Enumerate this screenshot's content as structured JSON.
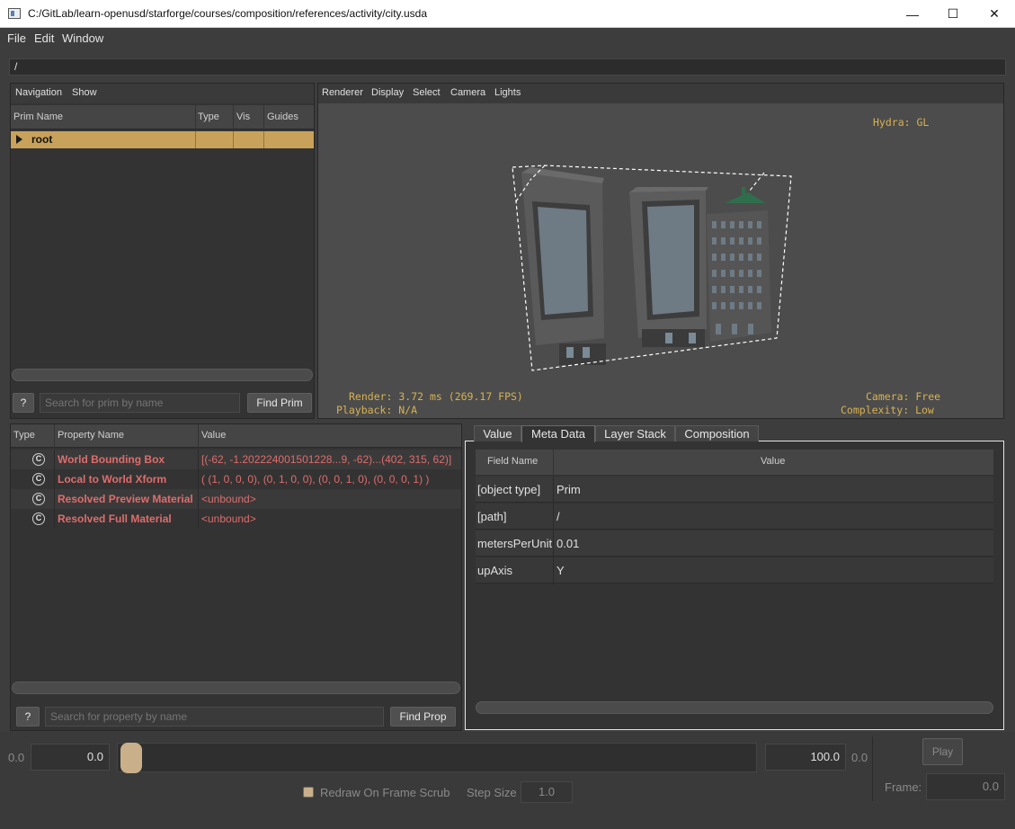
{
  "window": {
    "title": "C:/GitLab/learn-openusd/starforge/courses/composition/references/activity/city.usda",
    "minimize_glyph": "—",
    "maximize_glyph": "☐",
    "close_glyph": "✕"
  },
  "menubar": {
    "items": [
      "File",
      "Edit",
      "Window"
    ]
  },
  "path_field": {
    "value": "/"
  },
  "navigation": {
    "menu": [
      "Navigation",
      "Show"
    ],
    "columns": [
      "Prim Name",
      "Type",
      "Vis",
      "Guides"
    ],
    "rows": [
      {
        "name": "root",
        "type": "",
        "vis": "",
        "guides": ""
      }
    ],
    "help_label": "?",
    "search_placeholder": "Search for prim by name",
    "find_label": "Find Prim"
  },
  "viewport": {
    "menu": [
      "Renderer",
      "Display",
      "Select",
      "Camera",
      "Lights"
    ],
    "hud": {
      "renderer": "Hydra: GL",
      "render": "Render: 3.72 ms (269.17 FPS)",
      "playback": "Playback: N/A",
      "camera": "Camera: Free",
      "complexity": "Complexity: Low"
    }
  },
  "properties": {
    "columns": [
      "Type",
      "Property Name",
      "Value"
    ],
    "type_icon": "C",
    "rows": [
      {
        "name": "World Bounding Box",
        "value": "[(-62, -1.202224001501228...9, -62)...(402, 315, 62)]"
      },
      {
        "name": "Local to World Xform",
        "value": "( (1, 0, 0, 0), (0, 1, 0, 0), (0, 0, 1, 0), (0, 0, 0, 1) )"
      },
      {
        "name": "Resolved Preview Material",
        "value": "<unbound>"
      },
      {
        "name": "Resolved Full Material",
        "value": "<unbound>"
      }
    ],
    "help_label": "?",
    "search_placeholder": "Search for property by name",
    "find_label": "Find Prop"
  },
  "metadata": {
    "tabs": [
      "Value",
      "Meta Data",
      "Layer Stack",
      "Composition"
    ],
    "active_tab": "Meta Data",
    "columns": [
      "Field Name",
      "Value"
    ],
    "rows": [
      {
        "field": "[object type]",
        "value": "Prim"
      },
      {
        "field": "[path]",
        "value": "/"
      },
      {
        "field": "metersPerUnit",
        "value": "0.01"
      },
      {
        "field": "upAxis",
        "value": "Y"
      }
    ]
  },
  "timeline": {
    "range_start_label": "0.0",
    "start_value": "0.0",
    "end_value": "100.0",
    "range_end_label": "0.0",
    "play_label": "Play",
    "frame_label": "Frame:",
    "frame_value": "0.0",
    "redraw_label": "Redraw On Frame Scrub",
    "redraw_checked": false,
    "step_label": "Step Size",
    "step_value": "1.0"
  },
  "colors": {
    "accent_selected_row": "#c8a25a",
    "property_text": "#e06c6c",
    "hud_text": "#d9b24f"
  }
}
